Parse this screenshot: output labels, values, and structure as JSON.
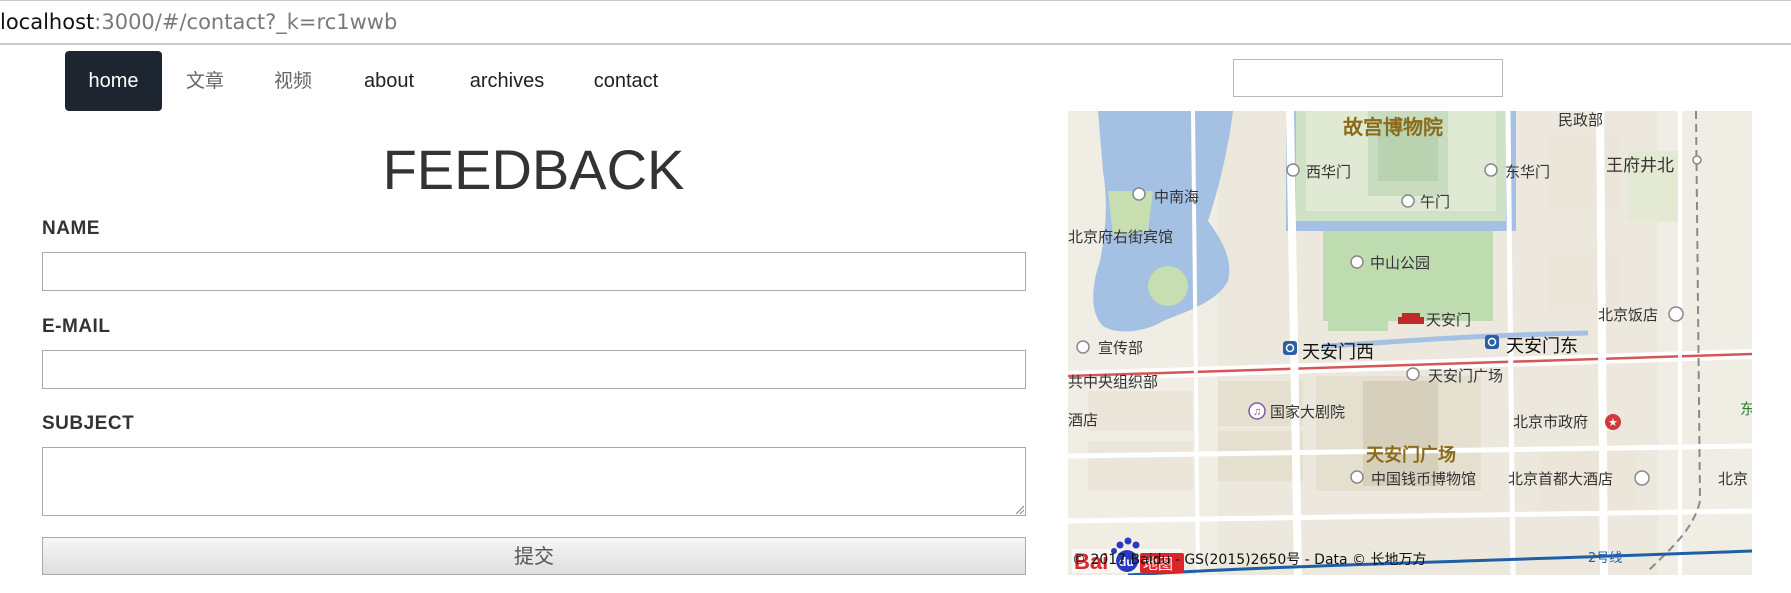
{
  "browser": {
    "url_host": "localhost",
    "url_rest": ":3000/#/contact?_k=rc1wwb"
  },
  "nav": {
    "items": [
      {
        "label": "home"
      },
      {
        "label": "文章"
      },
      {
        "label": "视频"
      },
      {
        "label": "about"
      },
      {
        "label": "archives"
      },
      {
        "label": "contact"
      }
    ],
    "search_value": ""
  },
  "form": {
    "title": "FEEDBACK",
    "name_label": "NAME",
    "email_label": "E-MAIL",
    "subject_label": "SUBJECT",
    "submit_label": "提交",
    "name_value": "",
    "email_value": "",
    "subject_value": ""
  },
  "map": {
    "labels": {
      "palace": "故宫博物院",
      "minwangmiao": "民政部",
      "wangfujing": "王府井北",
      "xihuamen": "西华门",
      "donghuamen": "东华门",
      "zhongnanhai": "中南海",
      "wumen": "午门",
      "youjie": "北京府右街宾馆",
      "zhongshan": "中山公园",
      "tiananmen": "天安门",
      "beijing_hotel": "北京饭店",
      "xuanchuan": "宣传部",
      "tiananmen_west": "天安门西",
      "tiananmen_east": "天安门东",
      "zuzhibu": "共中央组织部",
      "square_small": "天安门广场",
      "theater": "国家大剧院",
      "hotel_left": "酒店",
      "gov": "北京市政府",
      "square_big": "天安门广场",
      "coin": "中国钱币博物馆",
      "capital_hotel": "北京首都大酒店",
      "line2": "2号线",
      "beijing_right": "北京",
      "dong": "东"
    },
    "logo_text": "Bai  地图",
    "copyright": "© 2017 Baidu - GS(2015)2650号 - Data © 长地万方"
  }
}
